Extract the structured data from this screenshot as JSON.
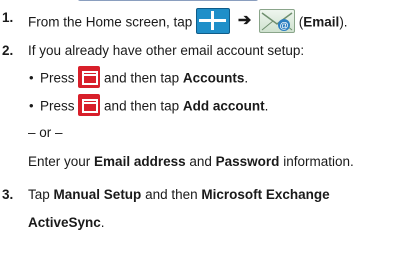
{
  "steps": [
    {
      "number": "1.",
      "prefix": "From the Home screen, tap",
      "arrow": "➔",
      "suffix": "(Email)",
      "suffix_bold_wrapped": "Email",
      "icons": [
        "apps-grid-icon",
        "email-app-icon"
      ]
    },
    {
      "number": "2.",
      "intro": "If you already have other email account setup:",
      "bullets": [
        {
          "press": "Press",
          "then": "and then tap",
          "target": "Accounts",
          "end": "."
        },
        {
          "press": "Press",
          "then": "and then tap",
          "target": "Add account",
          "end": "."
        }
      ],
      "or": "– or –",
      "alt_pre": "Enter your",
      "alt_b1": "Email address",
      "alt_and": "and",
      "alt_b2": "Password",
      "alt_post": "information."
    },
    {
      "number": "3.",
      "tap": "Tap",
      "b1": "Manual Setup",
      "then": "and then",
      "b2": "Microsoft Exchange",
      "b2_cont": "ActiveSync",
      "end": "."
    }
  ],
  "colors": {
    "apps_icon": "#1f8fc9",
    "menu_key": "#d81f2a",
    "text": "#1a1a1a"
  }
}
